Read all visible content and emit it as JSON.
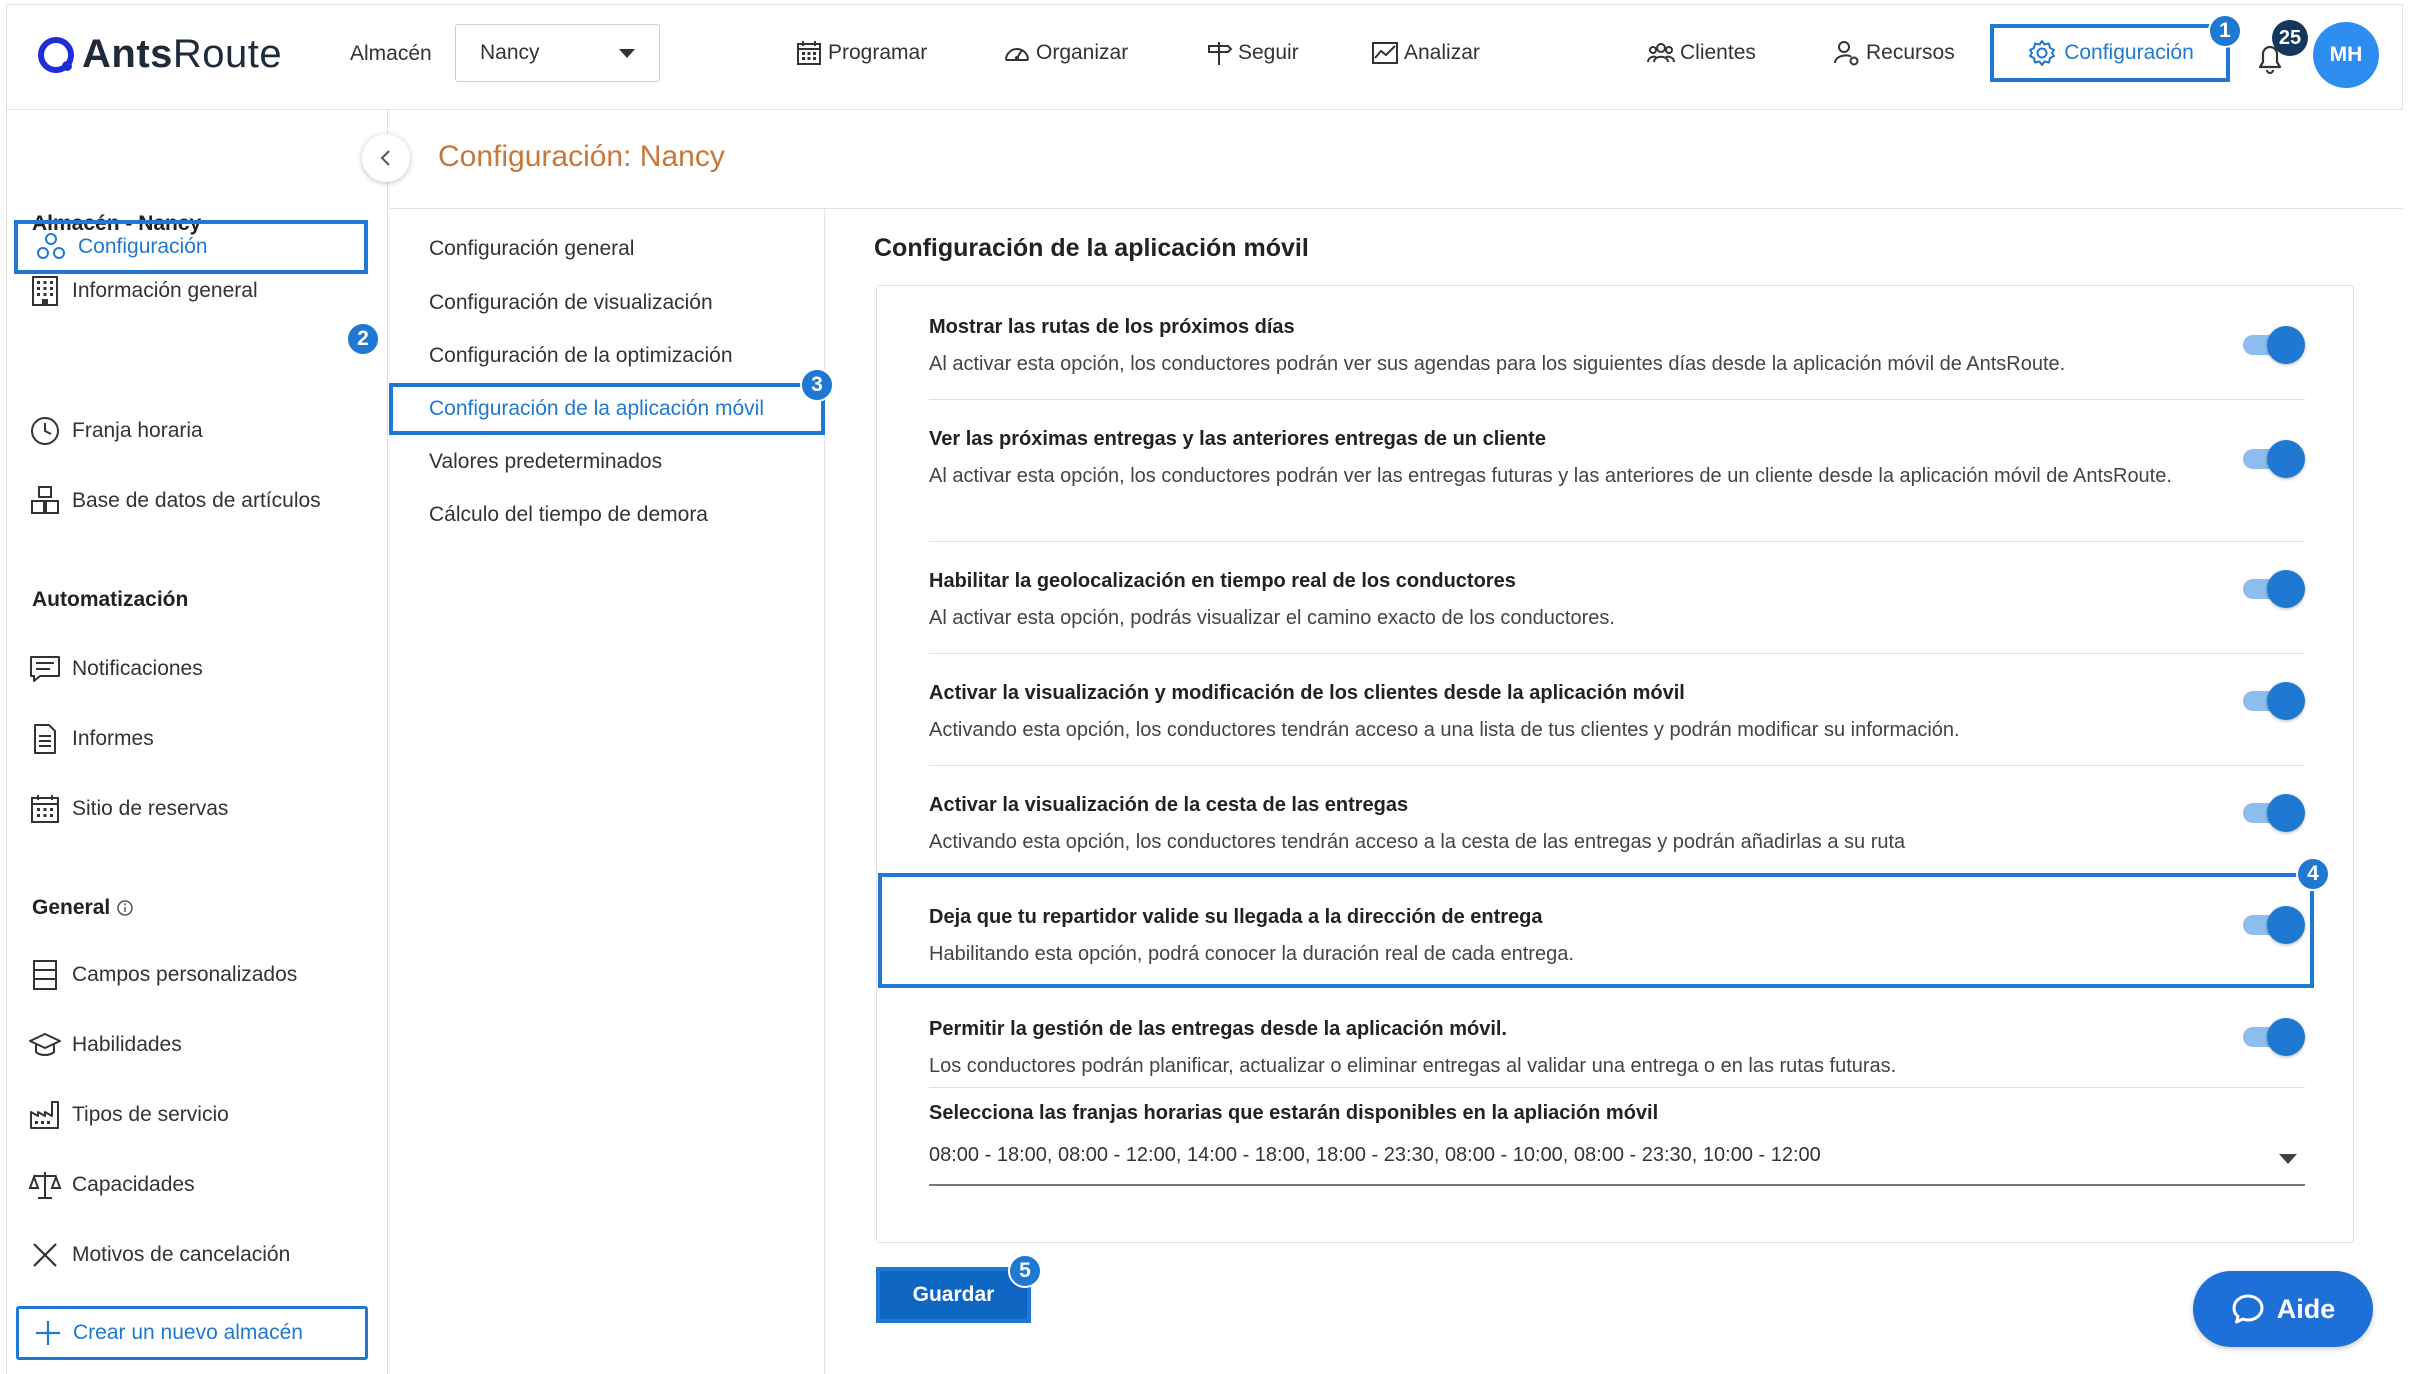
{
  "header": {
    "logo_ants": "Ants",
    "logo_route": "Route",
    "almacen_label": "Almacén",
    "almacen_value": "Nancy",
    "nav": [
      {
        "label": "Programar"
      },
      {
        "label": "Organizar"
      },
      {
        "label": "Seguir"
      },
      {
        "label": "Analizar"
      },
      {
        "label": "Clientes"
      },
      {
        "label": "Recursos"
      }
    ],
    "config_label": "Configuración",
    "notifications_count": "25",
    "avatar_initials": "MH"
  },
  "callouts": [
    "1",
    "2",
    "3",
    "4",
    "5"
  ],
  "page_title": "Configuración: Nancy",
  "sidebar": {
    "store_heading": "Almacén - Nancy",
    "store_items": [
      "Información general",
      "Configuración",
      "Franja horaria",
      "Base de datos de artículos"
    ],
    "automation_heading": "Automatización",
    "automation_items": [
      "Notificaciones",
      "Informes",
      "Sitio de reservas"
    ],
    "general_heading": "General",
    "general_items": [
      "Campos personalizados",
      "Habilidades",
      "Tipos de servicio",
      "Capacidades",
      "Motivos de cancelación"
    ],
    "create_label": "Crear un nuevo almacén"
  },
  "submenu": [
    "Configuración general",
    "Configuración de visualización",
    "Configuración de la optimización",
    "Configuración de la aplicación móvil",
    "Valores predeterminados",
    "Cálculo del tiempo de demora"
  ],
  "main": {
    "section_title": "Configuración de la aplicación móvil",
    "settings": [
      {
        "title": "Mostrar las rutas de los próximos días",
        "desc": "Al activar esta opción, los conductores podrán ver sus agendas para los siguientes días desde la aplicación móvil de AntsRoute.",
        "enabled": true
      },
      {
        "title": "Ver las próximas entregas y las anteriores entregas de un cliente",
        "desc": "Al activar esta opción, los conductores podrán ver las entregas futuras y las anteriores de un cliente desde la aplicación móvil de AntsRoute.",
        "enabled": true
      },
      {
        "title": "Habilitar la geolocalización en tiempo real de los conductores",
        "desc": "Al activar esta opción, podrás visualizar el camino exacto de los conductores.",
        "enabled": true
      },
      {
        "title": "Activar la visualización y modificación de los clientes desde la aplicación móvil",
        "desc": "Activando esta opción, los conductores tendrán acceso a una lista de tus clientes y podrán modificar su información.",
        "enabled": true
      },
      {
        "title": "Activar la visualización de la cesta de las entregas",
        "desc": "Activando esta opción, los conductores tendrán acceso a la cesta de las entregas y podrán añadirlas a su ruta",
        "enabled": true
      },
      {
        "title": "Deja que tu repartidor valide su llegada a la dirección de entrega",
        "desc": "Habilitando esta opción, podrá conocer la duración real de cada entrega.",
        "enabled": true
      },
      {
        "title": "Permitir la gestión de las entregas desde la aplicación móvil.",
        "desc": "Los conductores podrán planificar, actualizar o eliminar entregas al validar una entrega o en las rutas futuras.",
        "enabled": true
      }
    ],
    "slots_label": "Selecciona las franjas horarias que estarán disponibles en la apliación móvil",
    "slots_value": "08:00 - 18:00, 08:00 - 12:00, 14:00 - 18:00, 18:00 - 23:30, 08:00 - 10:00, 08:00 - 23:30, 10:00 - 12:00",
    "save_label": "Guardar"
  },
  "aide_label": "Aide",
  "colors": {
    "accent": "#1f78d1",
    "title_orange": "#c8773a",
    "avatar": "#2e8df0",
    "save": "#0f66c2"
  }
}
